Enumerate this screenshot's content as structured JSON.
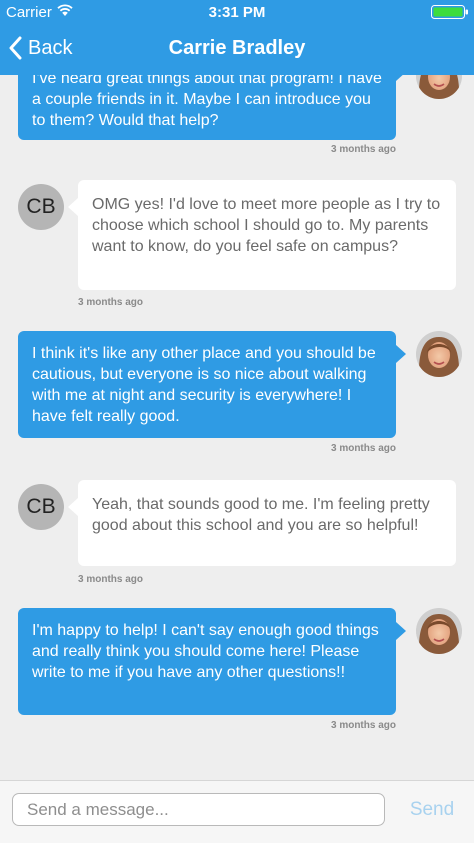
{
  "status_bar": {
    "carrier": "Carrier",
    "time": "3:31 PM"
  },
  "nav": {
    "back_label": "Back",
    "title": "Carrie Bradley"
  },
  "contact": {
    "initials": "CB"
  },
  "messages": [
    {
      "from": "me",
      "text": "I've heard great things about that program! I have a couple friends in it. Maybe I can introduce you to them? Would that help?",
      "time": "3 months ago"
    },
    {
      "from": "contact",
      "text": "OMG yes! I'd love to meet more people as I try to choose which school I should go to. My parents want to know, do you feel safe on campus?",
      "time": "3 months ago"
    },
    {
      "from": "me",
      "text": "I think it's like any other place and you should be cautious, but everyone is so nice about walking with me at night and security is everywhere! I have felt really good.",
      "time": "3 months ago"
    },
    {
      "from": "contact",
      "text": "Yeah, that sounds good to me. I'm feeling pretty good about this school and you are so helpful!",
      "time": "3 months ago"
    },
    {
      "from": "me",
      "text": "I'm happy to help! I can't say enough good things and really think you should come here! Please write to me if you have any other questions!!",
      "time": "3 months ago"
    }
  ],
  "composer": {
    "placeholder": "Send a message...",
    "send_label": "Send"
  },
  "colors": {
    "header": "#2f9be4",
    "outgoing_bubble": "#2f9be4",
    "incoming_bubble": "#ffffff",
    "background": "#eeeeee",
    "send_disabled": "#a8d2ef"
  }
}
